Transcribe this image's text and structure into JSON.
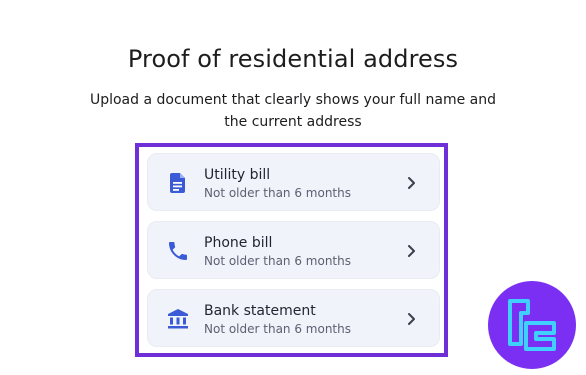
{
  "header": {
    "title": "Proof of residential address",
    "subtitle": "Upload a document that clearly shows your full name and the current address"
  },
  "options": [
    {
      "label": "Utility bill",
      "sublabel": "Not older than 6 months",
      "icon": "document-icon"
    },
    {
      "label": "Phone bill",
      "sublabel": "Not older than 6 months",
      "icon": "phone-icon"
    },
    {
      "label": "Bank statement",
      "sublabel": "Not older than 6 months",
      "icon": "bank-icon"
    }
  ],
  "colors": {
    "accent": "#3b5bd6",
    "highlight_border": "#6f2fd8",
    "card_bg": "#f1f3fa",
    "logo_bg": "#7b2ff2",
    "logo_stroke": "#3fd0ff"
  }
}
